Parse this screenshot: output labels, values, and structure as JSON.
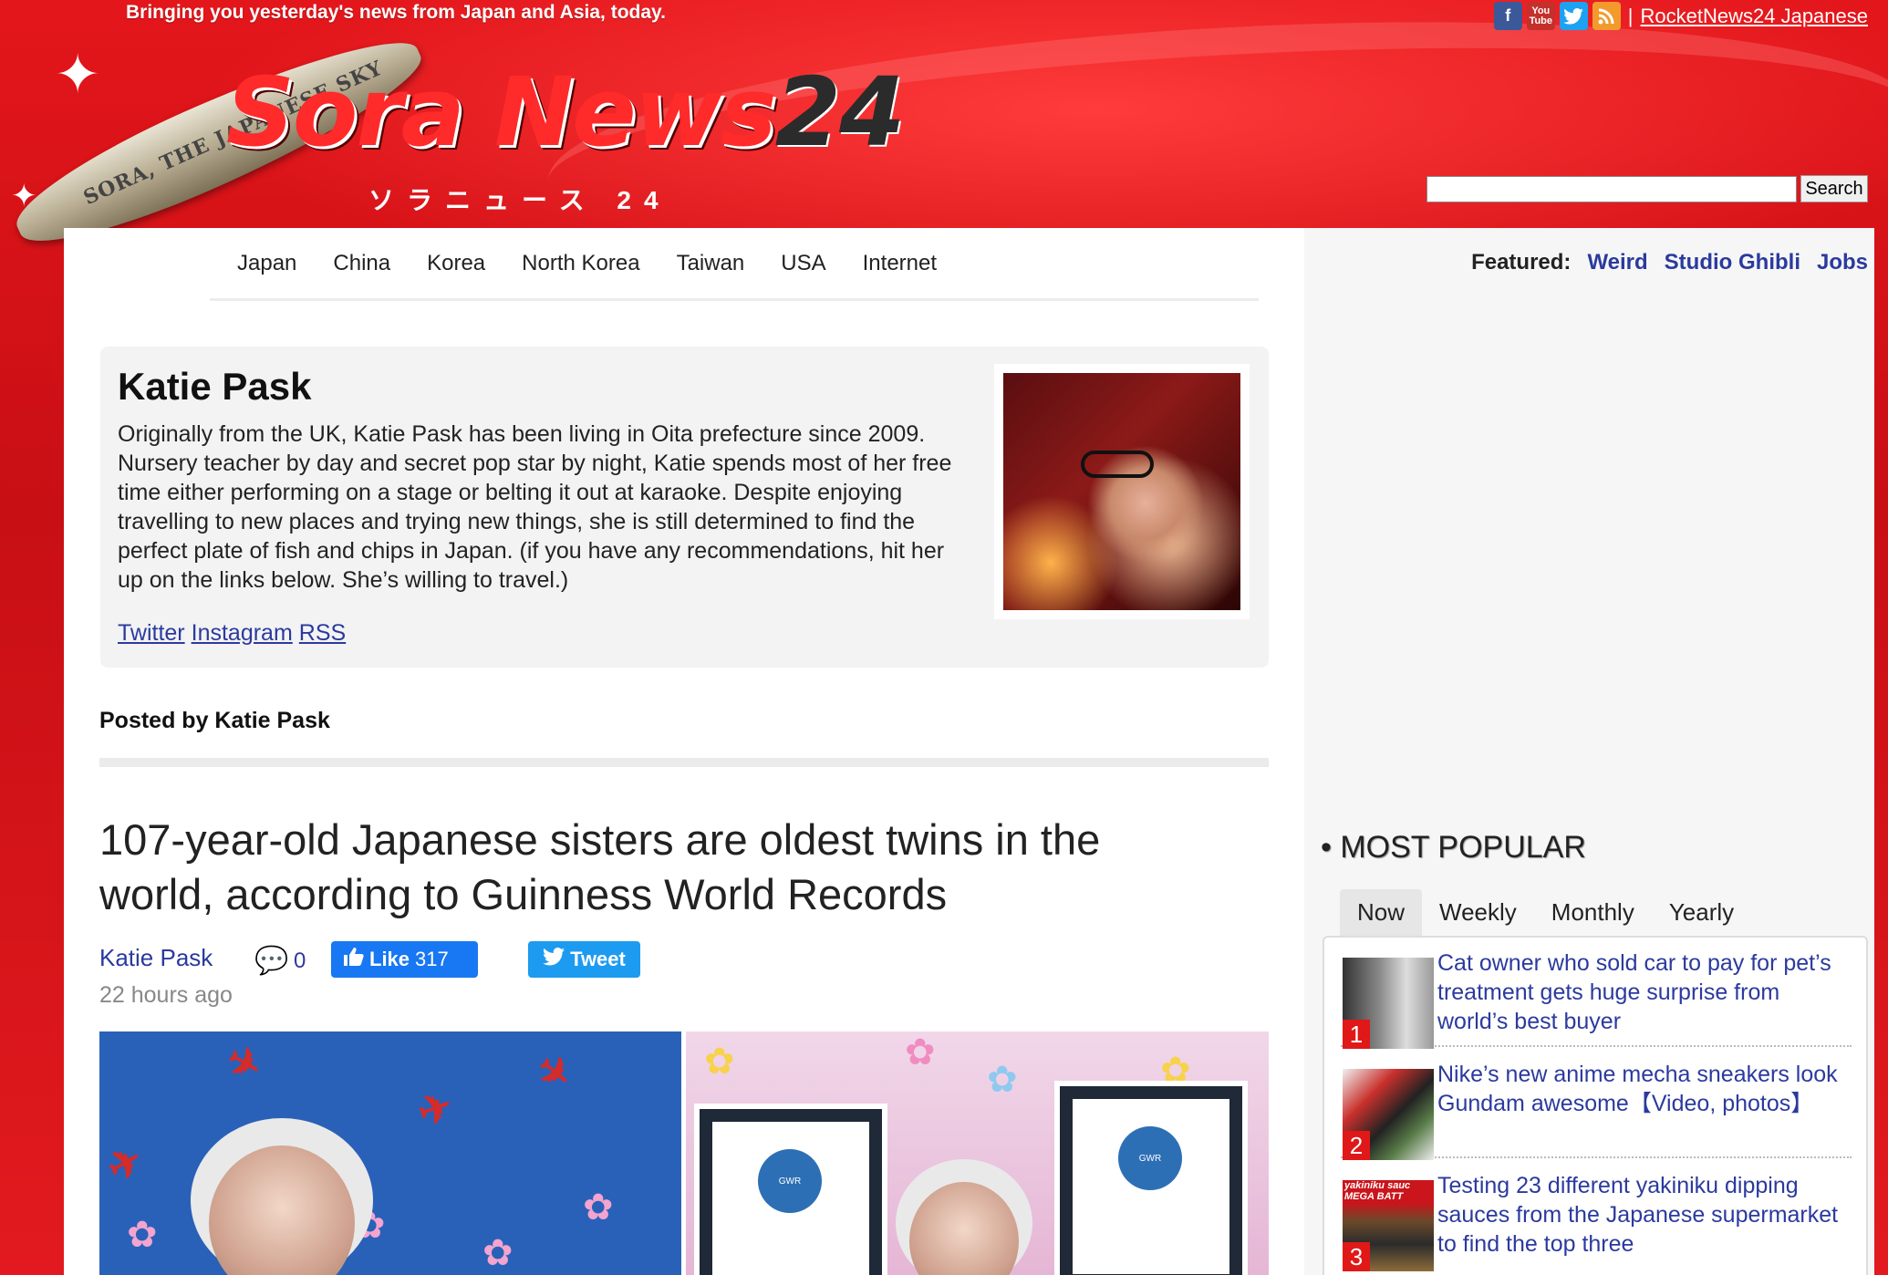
{
  "header": {
    "tagline": "Bringing you yesterday's news from Japan and Asia, today.",
    "social_icons": [
      "facebook-icon",
      "youtube-icon",
      "twitter-icon",
      "rss-icon"
    ],
    "separator": "|",
    "japanese_link": "RocketNews24 Japanese",
    "logo_text_sora": "Sora",
    "logo_text_news": "News",
    "logo_text_24": "24",
    "logo_sub": "ソラニュース 24",
    "rocket_text": "SORA, THE JAPANESE SKY",
    "search_button": "Search",
    "search_value": ""
  },
  "nav": {
    "items": [
      "Japan",
      "China",
      "Korea",
      "North Korea",
      "Taiwan",
      "USA",
      "Internet"
    ]
  },
  "featured": {
    "label": "Featured:",
    "links": [
      "Weird",
      "Studio Ghibli",
      "Jobs"
    ]
  },
  "author": {
    "name": "Katie Pask",
    "bio": "Originally from the UK, Katie Pask has been living in Oita prefecture since 2009. Nursery teacher by day and secret pop star by night, Katie spends most of her free time either performing on a stage or belting it out at karaoke. Despite enjoying travelling to new places and trying new things, she is still determined to find the perfect plate of fish and chips in Japan. (if you have any recommendations, hit her up on the links below. She’s willing to travel.)",
    "links": [
      "Twitter",
      "Instagram",
      "RSS"
    ]
  },
  "posted_by": "Posted by Katie Pask",
  "article": {
    "title": "107-year-old Japanese sisters are oldest twins in the world, according to Guinness World Records",
    "author": "Katie Pask",
    "comments": "0",
    "like_label": "Like",
    "like_count": "317",
    "tweet_label": "Tweet",
    "timestamp": "22 hours ago"
  },
  "sidebar": {
    "most_popular": "• MOST POPULAR",
    "tabs": [
      "Now",
      "Weekly",
      "Monthly",
      "Yearly"
    ],
    "active_tab": "Now",
    "items": [
      {
        "rank": "1",
        "title": "Cat owner who sold car to pay for pet’s treatment gets huge surprise from world’s best buyer"
      },
      {
        "rank": "2",
        "title": "Nike’s new anime mecha sneakers look Gundam awesome【Video, photos】"
      },
      {
        "rank": "3",
        "title": "Testing 23 different yakiniku dipping sauces from the Japanese supermarket to find the top three",
        "thumb_text": "yakiniku sauc MEGA BATT"
      }
    ]
  },
  "colors": {
    "brand_red": "#d8141a",
    "link_blue": "#2b3a9e",
    "facebook": "#1877f2",
    "twitter": "#1d9bf0"
  }
}
